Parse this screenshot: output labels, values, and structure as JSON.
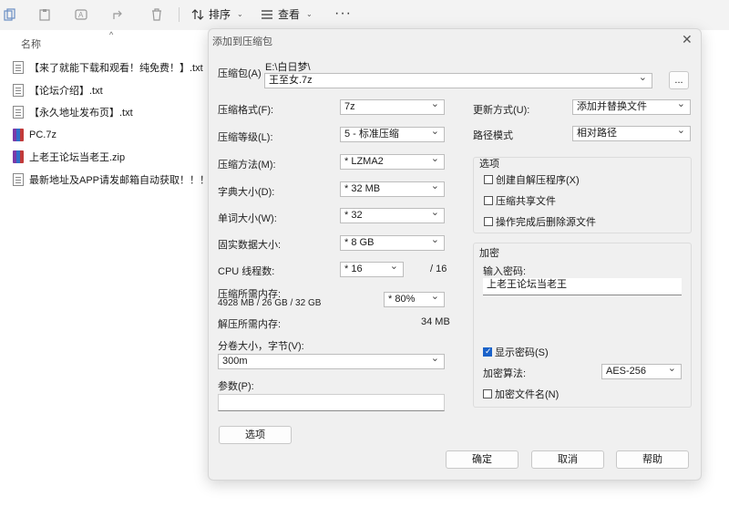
{
  "toolbar": {
    "sort_label": "排序",
    "view_label": "查看",
    "more": "···"
  },
  "filelist": {
    "column_name": "名称",
    "files": [
      {
        "name": "【来了就能下载和观看！纯免费！】.txt",
        "type": "txt"
      },
      {
        "name": "【论坛介绍】.txt",
        "type": "txt"
      },
      {
        "name": "【永久地址发布页】.txt",
        "type": "txt"
      },
      {
        "name": "PC.7z",
        "type": "rar"
      },
      {
        "name": "上老王论坛当老王.zip",
        "type": "rar"
      },
      {
        "name": "最新地址及APP请发邮箱自动获取！！！....",
        "type": "txt"
      }
    ]
  },
  "dialog": {
    "title": "添加到压缩包",
    "archive_label": "压缩包(A)",
    "archive_path": "E:\\白日梦\\",
    "archive_name": "王至女.7z",
    "browse_label": "...",
    "format_label": "压缩格式(F):",
    "format_value": "7z",
    "level_label": "压缩等级(L):",
    "level_value": "5 - 标准压缩",
    "method_label": "压缩方法(M):",
    "method_value": "* LZMA2",
    "dict_label": "字典大小(D):",
    "dict_value": "* 32 MB",
    "word_label": "单词大小(W):",
    "word_value": "* 32",
    "solid_label": "固实数据大小:",
    "solid_value": "* 8 GB",
    "cpu_label": "CPU 线程数:",
    "cpu_value": "* 16",
    "cpu_total": "/ 16",
    "mem_comp_label": "压缩所需内存:",
    "mem_comp_detail": "4928 MB / 26 GB / 32 GB",
    "mem_comp_value": "* 80%",
    "mem_decomp_label": "解压所需内存:",
    "mem_decomp_value": "34 MB",
    "volume_label": "分卷大小，字节(V):",
    "volume_value": "300m",
    "params_label": "参数(P):",
    "params_value": "",
    "options_button": "选项",
    "update_label": "更新方式(U):",
    "update_value": "添加并替换文件",
    "pathmode_label": "路径模式",
    "pathmode_value": "相对路径",
    "options_group": "选项",
    "opt_sfx": "创建自解压程序(X)",
    "opt_shared": "压缩共享文件",
    "opt_delete": "操作完成后删除源文件",
    "encrypt_group": "加密",
    "password_label": "输入密码:",
    "password_value": "上老王论坛当老王",
    "show_password": "显示密码(S)",
    "enc_method_label": "加密算法:",
    "enc_method_value": "AES-256",
    "enc_names": "加密文件名(N)",
    "ok": "确定",
    "cancel": "取消",
    "help": "帮助"
  }
}
